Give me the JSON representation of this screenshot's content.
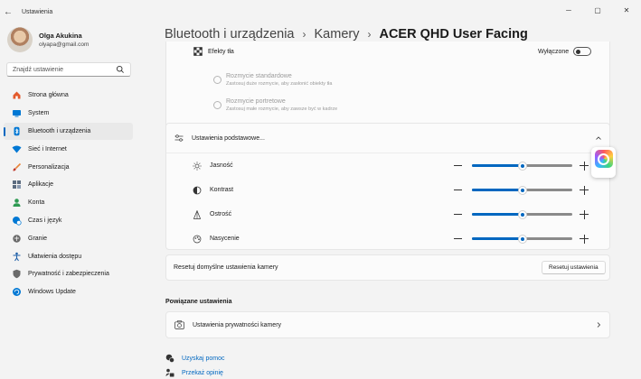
{
  "window": {
    "title": "Ustawienia"
  },
  "profile": {
    "name": "Olga Akukina",
    "email": "olyapa@gmail.com"
  },
  "search": {
    "placeholder": "Znajdź ustawienie"
  },
  "nav": [
    {
      "label": "Strona główna",
      "icon": "home-icon",
      "color": "#e35a2c"
    },
    {
      "label": "System",
      "icon": "system-icon",
      "color": "#0078d4"
    },
    {
      "label": "Bluetooth i urządzenia",
      "icon": "bluetooth-icon",
      "color": "#0078d4",
      "active": true
    },
    {
      "label": "Sieć i Internet",
      "icon": "wifi-icon",
      "color": "#0078d4"
    },
    {
      "label": "Personalizacja",
      "icon": "brush-icon",
      "color": "#e8853a"
    },
    {
      "label": "Aplikacje",
      "icon": "apps-icon",
      "color": "#5c6c80"
    },
    {
      "label": "Konta",
      "icon": "account-icon",
      "color": "#2e9a52"
    },
    {
      "label": "Czas i język",
      "icon": "globe-clock-icon",
      "color": "#0078d4"
    },
    {
      "label": "Granie",
      "icon": "gamepad-icon",
      "color": "#6a6a6a"
    },
    {
      "label": "Ułatwienia dostępu",
      "icon": "accessibility-icon",
      "color": "#1e5fa8"
    },
    {
      "label": "Prywatność i zabezpieczenia",
      "icon": "shield-icon",
      "color": "#6a6a6a"
    },
    {
      "label": "Windows Update",
      "icon": "update-icon",
      "color": "#0078d4"
    }
  ],
  "breadcrumb": {
    "level1": "Bluetooth i urządzenia",
    "level2": "Kamery",
    "current": "ACER QHD User Facing"
  },
  "background_effects": {
    "label": "Efekty tła",
    "state": "Wyłączone",
    "options": [
      {
        "title": "Rozmycie standardowe",
        "desc": "Zastosuj duże rozmycie, aby zasłonić obiekty tła"
      },
      {
        "title": "Rozmycie portretowe",
        "desc": "Zastosuj małe rozmycie, aby zawsze być w kadrze"
      }
    ]
  },
  "basic_settings": {
    "label": "Ustawienia podstawowe...",
    "sliders": [
      {
        "label": "Jasność",
        "icon": "brightness-icon",
        "value": 0.5
      },
      {
        "label": "Kontrast",
        "icon": "contrast-icon",
        "value": 0.5
      },
      {
        "label": "Ostrość",
        "icon": "sharpness-icon",
        "value": 0.5
      },
      {
        "label": "Nasycenie",
        "icon": "saturation-icon",
        "value": 0.5
      }
    ]
  },
  "reset": {
    "label": "Resetuj domyślne ustawienia kamery",
    "button": "Resetuj ustawienia"
  },
  "related": {
    "title": "Powiązane ustawienia",
    "privacy": "Ustawienia prywatności kamery"
  },
  "links": {
    "help": "Uzyskaj pomoc",
    "feedback": "Przekaż opinię"
  },
  "accent_color": "#0067c0"
}
